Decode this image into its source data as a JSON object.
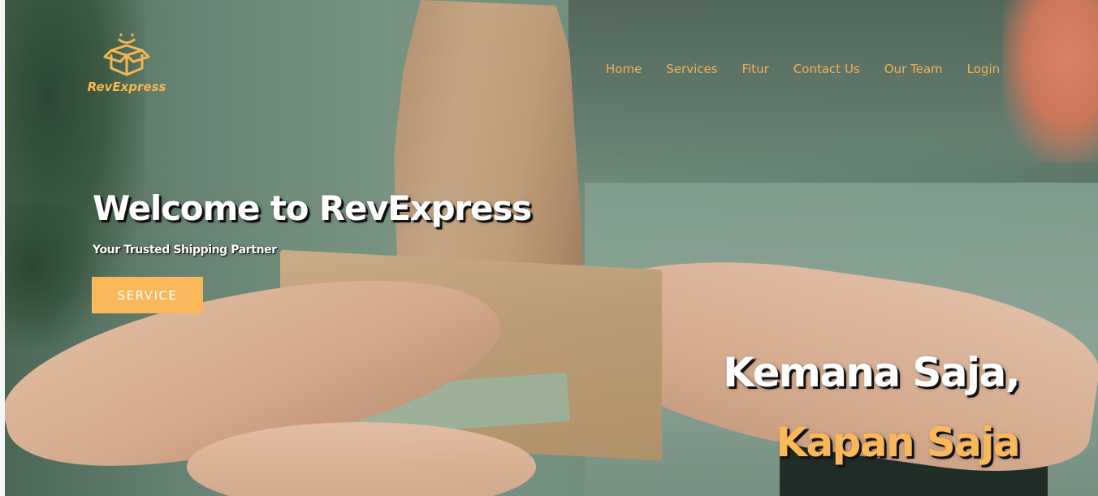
{
  "brand": {
    "name": "RevExpress",
    "logo_icon": "smiling-box-icon",
    "accent_color": "#fbb85a"
  },
  "nav": {
    "items": [
      {
        "label": "Home"
      },
      {
        "label": "Services"
      },
      {
        "label": "Fitur"
      },
      {
        "label": "Contact Us"
      },
      {
        "label": "Our Team"
      },
      {
        "label": "Login"
      }
    ]
  },
  "hero": {
    "title": "Welcome to RevExpress",
    "subtitle": "Your Trusted Shipping Partner",
    "cta_label": "SERVICE",
    "background_image": "hands-handing-over-parcel-photo"
  },
  "tagline": {
    "line1": "Kemana Saja,",
    "line2": "Kapan Saja"
  }
}
